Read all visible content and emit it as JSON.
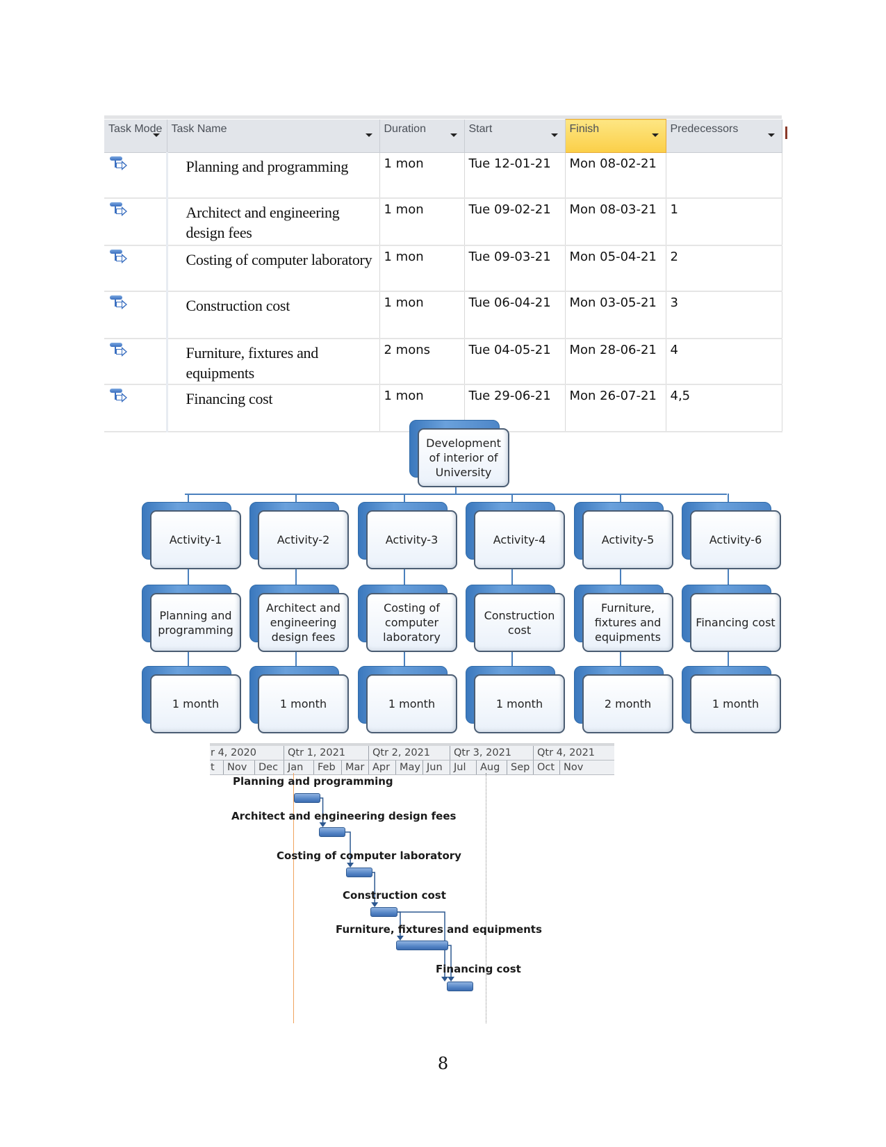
{
  "table": {
    "columns": [
      {
        "key": "mode",
        "label": "Task Mode"
      },
      {
        "key": "name",
        "label": "Task Name"
      },
      {
        "key": "duration",
        "label": "Duration"
      },
      {
        "key": "start",
        "label": "Start"
      },
      {
        "key": "finish",
        "label": "Finish"
      },
      {
        "key": "predecessors",
        "label": "Predecessors"
      }
    ],
    "rows": [
      {
        "mode_icon": "auto-scheduled-task-icon",
        "name": "Planning and programming",
        "duration": "1 mon",
        "start": "Tue 12-01-21",
        "finish": "Mon 08-02-21",
        "predecessors": ""
      },
      {
        "mode_icon": "auto-scheduled-task-icon",
        "name": "Architect and engineering design fees",
        "duration": "1 mon",
        "start": "Tue 09-02-21",
        "finish": "Mon 08-03-21",
        "predecessors": "1"
      },
      {
        "mode_icon": "auto-scheduled-task-icon",
        "name": "Costing of computer laboratory",
        "duration": "1 mon",
        "start": "Tue 09-03-21",
        "finish": "Mon 05-04-21",
        "predecessors": "2"
      },
      {
        "mode_icon": "auto-scheduled-task-icon",
        "name": "Construction cost",
        "duration": "1 mon",
        "start": "Tue 06-04-21",
        "finish": "Mon 03-05-21",
        "predecessors": "3"
      },
      {
        "mode_icon": "auto-scheduled-task-icon",
        "name": "Furniture, fixtures and equipments",
        "duration": "2 mons",
        "start": "Tue 04-05-21",
        "finish": "Mon 28-06-21",
        "predecessors": "4"
      },
      {
        "mode_icon": "auto-scheduled-task-icon",
        "name": "Financing cost",
        "duration": "1 mon",
        "start": "Tue 29-06-21",
        "finish": "Mon 26-07-21",
        "predecessors": "4,5"
      }
    ]
  },
  "orgchart": {
    "root": "Development of interior of University",
    "branches": [
      {
        "activity": "Activity-1",
        "task": "Planning and programming",
        "duration": "1 month"
      },
      {
        "activity": "Activity-2",
        "task": "Architect and engineering design fees",
        "duration": "1 month"
      },
      {
        "activity": "Activity-3",
        "task": "Costing of computer laboratory",
        "duration": "1 month"
      },
      {
        "activity": "Activity-4",
        "task": "Construction cost",
        "duration": "1 month"
      },
      {
        "activity": "Activity-5",
        "task": "Furniture, fixtures and equipments",
        "duration": "2 month"
      },
      {
        "activity": "Activity-6",
        "task": "Financing cost",
        "duration": "1 month"
      }
    ]
  },
  "gantt": {
    "quarters": [
      "r 4, 2020",
      "Qtr 1, 2021",
      "Qtr 2, 2021",
      "Qtr 3, 2021",
      "Qtr 4, 2021"
    ],
    "months": [
      "t",
      "Nov",
      "Dec",
      "Jan",
      "Feb",
      "Mar",
      "Apr",
      "May",
      "Jun",
      "Jul",
      "Aug",
      "Sep",
      "Oct",
      "Nov"
    ],
    "tasks": [
      {
        "label": "Planning and programming",
        "start_month": 0.38,
        "duration_months": 0.92
      },
      {
        "label": "Architect and engineering design fees",
        "start_month": 1.28,
        "duration_months": 0.92
      },
      {
        "label": "Costing of computer laboratory",
        "start_month": 2.28,
        "duration_months": 0.92
      },
      {
        "label": "Construction cost",
        "start_month": 3.17,
        "duration_months": 0.92
      },
      {
        "label": "Furniture, fixtures and equipments",
        "start_month": 4.1,
        "duration_months": 1.85
      },
      {
        "label": "Financing cost",
        "start_month": 5.95,
        "duration_months": 0.92
      }
    ]
  },
  "page_number": "8"
}
